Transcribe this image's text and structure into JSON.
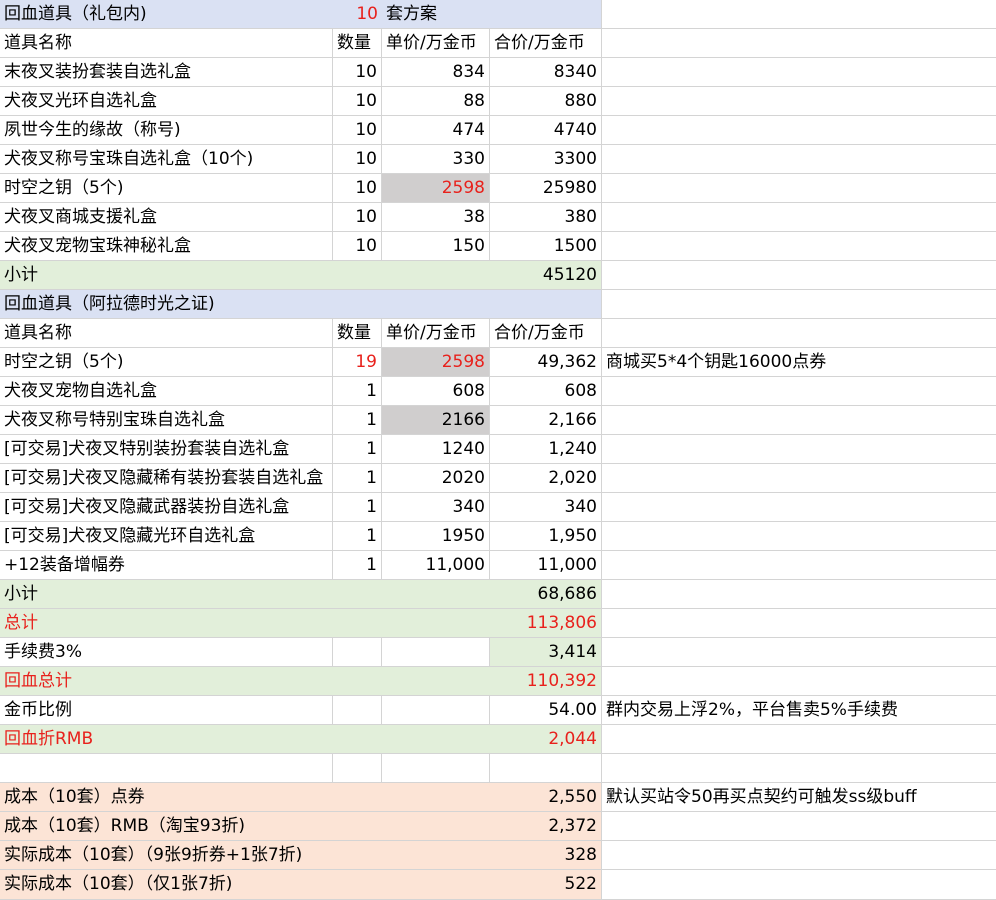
{
  "section1": {
    "title": "回血道具（礼包内)",
    "qty": "10",
    "qty_unit": "套方案",
    "header": [
      "道具名称",
      "数量",
      "单价/万金币",
      "合价/万金币"
    ],
    "rows": [
      {
        "name": "末夜叉装扮套装自选礼盒",
        "qty": "10",
        "price": "834",
        "total": "8340"
      },
      {
        "name": "犬夜叉光环自选礼盒",
        "qty": "10",
        "price": "88",
        "total": "880"
      },
      {
        "name": "夙世今生的缘故（称号)",
        "qty": "10",
        "price": "474",
        "total": "4740"
      },
      {
        "name": "犬夜叉称号宝珠自选礼盒（10个)",
        "qty": "10",
        "price": "330",
        "total": "3300"
      },
      {
        "name": "时空之钥（5个)",
        "qty": "10",
        "price": "2598",
        "total": "25980"
      },
      {
        "name": "犬夜叉商城支援礼盒",
        "qty": "10",
        "price": "38",
        "total": "380"
      },
      {
        "name": "犬夜叉宠物宝珠神秘礼盒",
        "qty": "10",
        "price": "150",
        "total": "1500"
      }
    ],
    "subtotal_label": "小计",
    "subtotal": "45120"
  },
  "section2": {
    "title": "回血道具（阿拉德时光之证)",
    "header": [
      "道具名称",
      "数量",
      "单价/万金币",
      "合价/万金币"
    ],
    "rows": [
      {
        "name": "时空之钥（5个)",
        "qty": "19",
        "price": "2598",
        "total": "49,362",
        "note": "商城买5*4个钥匙16000点券"
      },
      {
        "name": "犬夜叉宠物自选礼盒",
        "qty": "1",
        "price": "608",
        "total": "608",
        "note": ""
      },
      {
        "name": "犬夜叉称号特别宝珠自选礼盒",
        "qty": "1",
        "price": "2166",
        "total": "2,166",
        "note": ""
      },
      {
        "name": "[可交易]犬夜叉特别装扮套装自选礼盒",
        "qty": "1",
        "price": "1240",
        "total": "1,240",
        "note": ""
      },
      {
        "name": "[可交易]犬夜叉隐藏稀有装扮套装自选礼盒",
        "qty": "1",
        "price": "2020",
        "total": "2,020",
        "note": ""
      },
      {
        "name": "[可交易]犬夜叉隐藏武器装扮自选礼盒",
        "qty": "1",
        "price": "340",
        "total": "340",
        "note": ""
      },
      {
        "name": "[可交易]犬夜叉隐藏光环自选礼盒",
        "qty": "1",
        "price": "1950",
        "total": "1,950",
        "note": ""
      },
      {
        "name": "+12装备增幅券",
        "qty": "1",
        "price": "11,000",
        "total": "11,000",
        "note": ""
      }
    ],
    "subtotal_label": "小计",
    "subtotal": "68,686"
  },
  "summary": {
    "total_label": "总计",
    "total": "113,806",
    "fee_label": "手续费3%",
    "fee": "3,414",
    "return_total_label": "回血总计",
    "return_total": "110,392",
    "gold_ratio_label": "金币比例",
    "gold_ratio": "54.00",
    "gold_ratio_note": "群内交易上浮2%，平台售卖5%手续费",
    "rmb_label": "回血折RMB",
    "rmb": "2,044"
  },
  "costs": [
    {
      "label": "成本（10套）点券",
      "value": "2,550",
      "note": "默认买站令50再买点契约可触发ss级buff"
    },
    {
      "label": "成本（10套）RMB（淘宝93折)",
      "value": "2,372",
      "note": ""
    },
    {
      "label": "实际成本（10套）（9张9折券+1张7折)",
      "value": "328",
      "note": ""
    },
    {
      "label": "实际成本（10套）（仅1张7折)",
      "value": "522",
      "note": ""
    }
  ]
}
